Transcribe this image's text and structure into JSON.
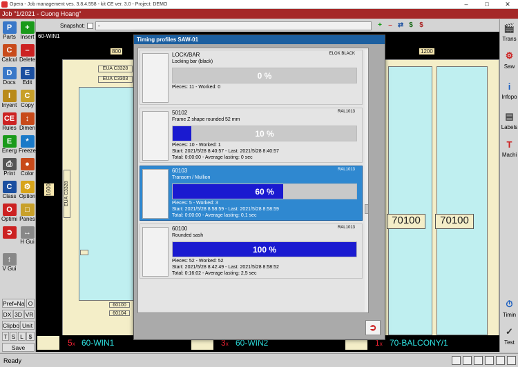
{
  "title": "Opera - Job management ves. 3.8.4.558 - kit CE ver. 3.0 - Project: DEMO",
  "job": "Job \"1/2021 - Cuong Hoang\"",
  "snapshot": {
    "label": "Snapshot:",
    "value": "-"
  },
  "left_toolbar": [
    {
      "label": "Parts",
      "icon": "parts-icon"
    },
    {
      "label": "Insert",
      "icon": "plus-icon"
    },
    {
      "label": "Calcul",
      "icon": "calculator-icon"
    },
    {
      "label": "Delete",
      "icon": "minus-icon"
    },
    {
      "label": "Docs",
      "icon": "docs-icon"
    },
    {
      "label": "Edit",
      "icon": "edit-icon"
    },
    {
      "label": "Inyent",
      "icon": "inventory-icon"
    },
    {
      "label": "Copy",
      "icon": "copy-icon"
    },
    {
      "label": "Rules",
      "icon": "ce-icon"
    },
    {
      "label": "Dimen",
      "icon": "dimension-icon"
    },
    {
      "label": "Energ",
      "icon": "energy-icon"
    },
    {
      "label": "Freeze",
      "icon": "freeze-icon"
    },
    {
      "label": "Print",
      "icon": "print-icon"
    },
    {
      "label": "Color",
      "icon": "color-icon"
    },
    {
      "label": "Class",
      "icon": "class-icon"
    },
    {
      "label": "Option",
      "icon": "option-icon"
    },
    {
      "label": "Optimi",
      "icon": "optimize-icon"
    },
    {
      "label": "Panes",
      "icon": "panes-icon"
    },
    {
      "label": "",
      "icon": "exit-icon"
    },
    {
      "label": "H Gui",
      "icon": "h-guide-icon"
    },
    {
      "label": "V Gui",
      "icon": "v-guide-icon"
    }
  ],
  "left_small": {
    "pref": "Pref=Na",
    "o": "O",
    "dx": "DX",
    "d3": "3D",
    "vr": "VR",
    "clipbo": "Clipbo",
    "unit": "Unit",
    "t": "T",
    "s": "S",
    "l": "L",
    "dollar": "$",
    "save": "Save"
  },
  "right_toolbar": [
    {
      "label": "Trans",
      "icon": "trans-icon"
    },
    {
      "label": "Saw",
      "icon": "saw-icon"
    },
    {
      "label": "Infopo",
      "icon": "info-icon"
    },
    {
      "label": "Labels",
      "icon": "labels-icon"
    },
    {
      "label": "Machi",
      "icon": "machine-icon"
    },
    {
      "label": "Timin",
      "icon": "timer-icon"
    },
    {
      "label": "Test",
      "icon": "test-icon"
    }
  ],
  "drawing": {
    "window_name": "60-WIN1",
    "dims": {
      "w1": "800",
      "h1": "1600",
      "w2": "1200"
    },
    "tags": {
      "a": "EUA C3328",
      "b": "EUA C3303",
      "c": "EUA C3328",
      "d": "60100",
      "e": "60100",
      "f": "60104",
      "g": "60100"
    },
    "big_tags": [
      "70100",
      "70100"
    ]
  },
  "bottom_items": [
    {
      "qty": "5",
      "x": "x",
      "name": "60-WIN1"
    },
    {
      "qty": "3",
      "x": "x",
      "name": "60-WIN2"
    },
    {
      "qty": "1",
      "x": "x",
      "name": "70-BALCONY/1"
    }
  ],
  "dialog": {
    "title": "Timing profiles SAW-01",
    "rows": [
      {
        "code": "LOCK/BAR",
        "color": "ELOX BLACK",
        "desc": "Locking bar (black)",
        "progress": 0,
        "pct": "0 %",
        "pieces": "Pieces: 11 - Worked: 0",
        "start": "",
        "total": "",
        "selected": false
      },
      {
        "code": "50102",
        "color": "RAL1013",
        "desc": "Frame Z shape rounded 52 mm",
        "progress": 10,
        "pct": "10 %",
        "pieces": "Pieces: 10 - Worked: 1",
        "start": "Start: 2021/5/28 8:40:57 - Last: 2021/5/28 8:40:57",
        "total": "Total:  0:00:00 - Average lasting: 0 sec",
        "selected": false
      },
      {
        "code": "60103",
        "color": "RAL1013",
        "desc": "Transom / Mullion",
        "progress": 60,
        "pct": "60 %",
        "pieces": "Pieces: 5 - Worked: 3",
        "start": "Start: 2021/5/28 8:58:59 - Last: 2021/5/28 8:58:59",
        "total": "Total:  0:00:00 - Average lasting: 0,1 sec",
        "selected": true
      },
      {
        "code": "60100",
        "color": "RAL1013",
        "desc": "Rounded sash",
        "progress": 100,
        "pct": "100 %",
        "pieces": "Pieces: 52 - Worked: 52",
        "start": "Start: 2021/5/28 8:42:49 - Last: 2021/5/28 8:58:52",
        "total": "Total:  0:16:02 - Average lasting: 2,5 sec",
        "selected": false
      }
    ]
  },
  "status": "Ready",
  "colors": {
    "job_bar": "#a52828",
    "dialog_title": "#1c5fa0",
    "progress": "#1a1ad0",
    "selected_row": "#2f88d0"
  }
}
